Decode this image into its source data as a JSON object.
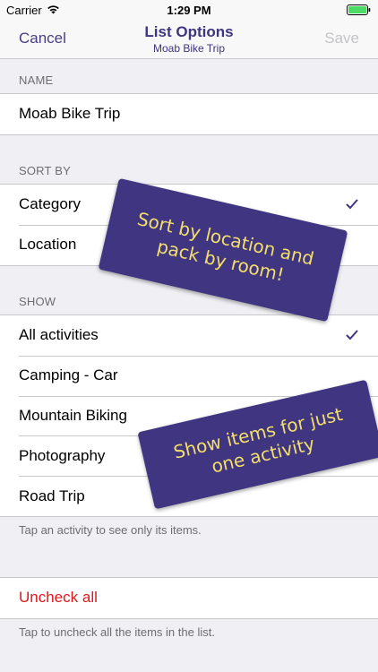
{
  "status_bar": {
    "carrier": "Carrier",
    "time": "1:29 PM"
  },
  "nav": {
    "cancel": "Cancel",
    "title": "List Options",
    "subtitle": "Moab Bike Trip",
    "save": "Save"
  },
  "name_section": {
    "header": "NAME",
    "value": "Moab Bike Trip"
  },
  "sort_section": {
    "header": "SORT BY",
    "items": [
      {
        "label": "Category",
        "checked": true
      },
      {
        "label": "Location",
        "checked": false
      }
    ]
  },
  "show_section": {
    "header": "SHOW",
    "items": [
      {
        "label": "All activities",
        "checked": true
      },
      {
        "label": "Camping - Car",
        "checked": false
      },
      {
        "label": "Mountain Biking",
        "checked": false
      },
      {
        "label": "Photography",
        "checked": false
      },
      {
        "label": "Road Trip",
        "checked": false
      }
    ],
    "footer": "Tap an activity to see only its items."
  },
  "uncheck_section": {
    "label": "Uncheck all",
    "footer": "Tap to uncheck all the items in the list."
  },
  "banners": {
    "sort_line1": "Sort by location and",
    "sort_line2": "pack by room!",
    "show_line1": "Show items for just",
    "show_line2": "one activity"
  },
  "colors": {
    "accent": "#3f3580",
    "banner_text": "#f4df6b",
    "destructive": "#e0181b",
    "disabled": "#c4c4c8"
  }
}
